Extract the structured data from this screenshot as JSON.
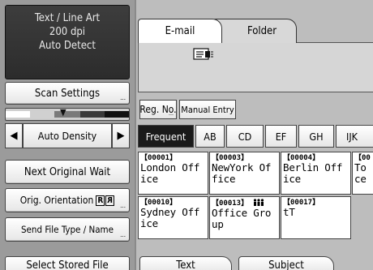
{
  "status": {
    "line1": "Text / Line Art",
    "line2": "200 dpi",
    "line3": "Auto Detect"
  },
  "left_buttons": {
    "scan_settings": "Scan Settings",
    "auto_density": "Auto Density",
    "density_left_arrow": "◀",
    "density_right_arrow": "▶",
    "density_marker": "▼",
    "next_original_wait": "Next Original Wait",
    "orig_orientation": "Orig. Orientation",
    "send_file_type": "Send File Type / Name",
    "select_stored_file": "Select Stored File",
    "more_indicator": "..."
  },
  "orientation_badges": [
    "R",
    "R"
  ],
  "top_tabs": {
    "email": "E-mail",
    "folder": "Folder"
  },
  "toolbar": {
    "reg_no": "Reg. No.",
    "manual_entry": "Manual Entry"
  },
  "title_tabs": [
    "Frequent",
    "AB",
    "CD",
    "EF",
    "GH",
    "IJK"
  ],
  "active_title_tab": "Frequent",
  "entries": [
    {
      "num": "【00001】",
      "line1": "London Off",
      "line2": "ice"
    },
    {
      "num": "【00003】",
      "line1": "NewYork Of",
      "line2": "fice"
    },
    {
      "num": "【00004】",
      "line1": "Berlin Off",
      "line2": "ice"
    },
    {
      "num": "【00",
      "line1": "To",
      "line2": "ce"
    },
    {
      "num": "【00010】",
      "line1": "Sydney Off",
      "line2": "ice"
    },
    {
      "num": "【00013】",
      "group_icon": "group-icon",
      "line1": "Office Gro",
      "line2": "up"
    },
    {
      "num": "【00017】",
      "line1": "tT",
      "line2": ""
    }
  ],
  "bottom_tabs": {
    "text": "Text",
    "subject": "Subject"
  },
  "icons": {
    "destination": "address-book-icon",
    "group": "group-icon"
  },
  "colors": {
    "status_bg": "#333333",
    "active_tab": "#1a1a1a",
    "panel_bg": "#bdbdbd"
  }
}
